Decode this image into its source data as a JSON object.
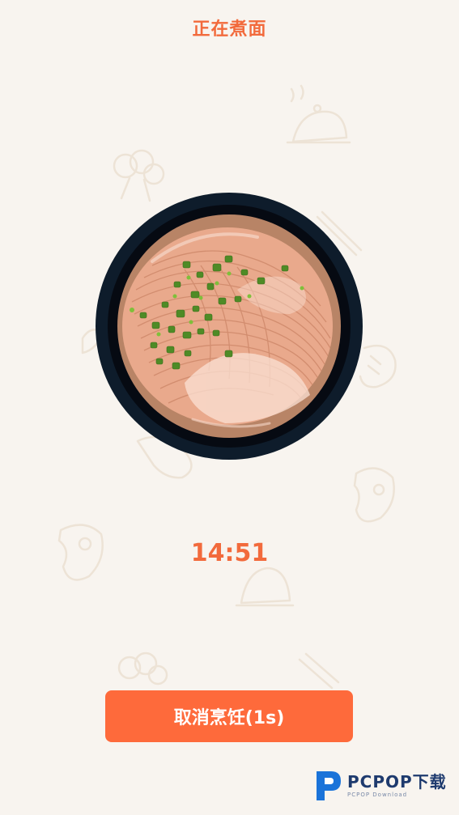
{
  "header": {
    "title": "正在煮面"
  },
  "cooking": {
    "timer": "14:51",
    "dish_image": "noodle-bowl"
  },
  "actions": {
    "cancel_label": "取消烹饪(1s)"
  },
  "watermark": {
    "brand": "PCPOP下载",
    "sub": "PCPOP Download"
  },
  "colors": {
    "accent": "#fe6a3b",
    "background": "#f8f4ef",
    "bowl_rim": "#0e1c2b",
    "broth": "#e8a68a",
    "scallion": "#4f8b26"
  },
  "decor": [
    "cloche-icon",
    "broccoli-icon",
    "fork-knife-icon",
    "shrimp-icon",
    "steak-icon",
    "chicken-leg-icon"
  ]
}
